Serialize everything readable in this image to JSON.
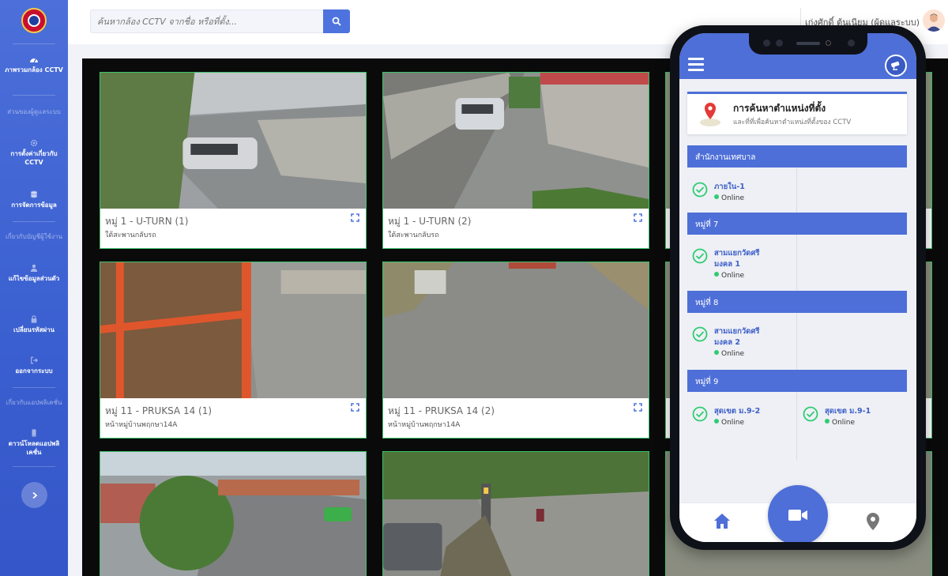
{
  "sidebar": {
    "items": [
      {
        "label": "ภาพรวมกล้อง CCTV",
        "icon": "dashboard-icon",
        "muted": false
      },
      {
        "label": "ส่วนของผู้ดูแลระบบ",
        "icon": "",
        "muted": true
      },
      {
        "label": "การตั้งค่าเกี่ยวกับ CCTV",
        "icon": "gear-icon",
        "muted": false
      },
      {
        "label": "การจัดการข้อมูล",
        "icon": "database-icon",
        "muted": false
      },
      {
        "label": "เกี่ยวกับบัญชีผู้ใช้งาน",
        "icon": "",
        "muted": true
      },
      {
        "label": "แก้ไขข้อมูลส่วนตัว",
        "icon": "user-icon",
        "muted": false
      },
      {
        "label": "เปลี่ยนรหัสผ่าน",
        "icon": "lock-icon",
        "muted": false
      },
      {
        "label": "ออกจากระบบ",
        "icon": "sign-out-icon",
        "muted": false
      },
      {
        "label": "เกี่ยวกับแอปพลิเคชั่น",
        "icon": "",
        "muted": true
      },
      {
        "label": "ดาวน์โหลดแอปพลิเคชั่น",
        "icon": "mobile-icon",
        "muted": false
      }
    ],
    "toggle_icon": "chevron-right-icon"
  },
  "topbar": {
    "search_placeholder": "ค้นหากล้อง CCTV จากชื่อ หรือที่ตั้ง...",
    "search_icon": "search-icon",
    "user_name": "เก่งศักดิ์ ต้นเนียม (ผู้ดูแลระบบ)"
  },
  "cameras": [
    {
      "title": "หมู่ 1 - U-TURN (1)",
      "subtitle": "ใต้สะพานกลับรถ"
    },
    {
      "title": "หมู่ 1 - U-TURN (2)",
      "subtitle": "ใต้สะพานกลับรถ"
    },
    {
      "title": "หมู่ 11 - PRUKSA 14 (1)",
      "subtitle": "หน้าหมู่บ้านพฤกษา14A"
    },
    {
      "title": "หมู่ 11 - PRUKSA 14 (2)",
      "subtitle": "หน้าหมู่บ้านพฤกษา14A"
    }
  ],
  "phone": {
    "location_card": {
      "title": "การค้นหาตำแหน่งที่ตั้ง",
      "subtitle": "และที่ที่เพื่อค้นหาตำแหน่งที่ตั้งของ CCTV"
    },
    "sections": [
      {
        "name": "สำนักงานเทศบาล",
        "stations": [
          {
            "name": "ภายใน-1",
            "status": "Online"
          }
        ]
      },
      {
        "name": "หมู่ที่ 7",
        "stations": [
          {
            "name": "สามแยกวัดศรีมงคล 1",
            "status": "Online"
          }
        ]
      },
      {
        "name": "หมู่ที่ 8",
        "stations": [
          {
            "name": "สามแยกวัดศรีมงคล 2",
            "status": "Online"
          }
        ]
      },
      {
        "name": "หมู่ที่ 9",
        "stations": [
          {
            "name": "สุดเขต ม.9-2",
            "status": "Online"
          },
          {
            "name": "สุดเขต ม.9-1",
            "status": "Online"
          }
        ]
      }
    ]
  },
  "colors": {
    "primary": "#4e6fd8",
    "online": "#2ecc71",
    "cam_border": "#3ac46c"
  }
}
